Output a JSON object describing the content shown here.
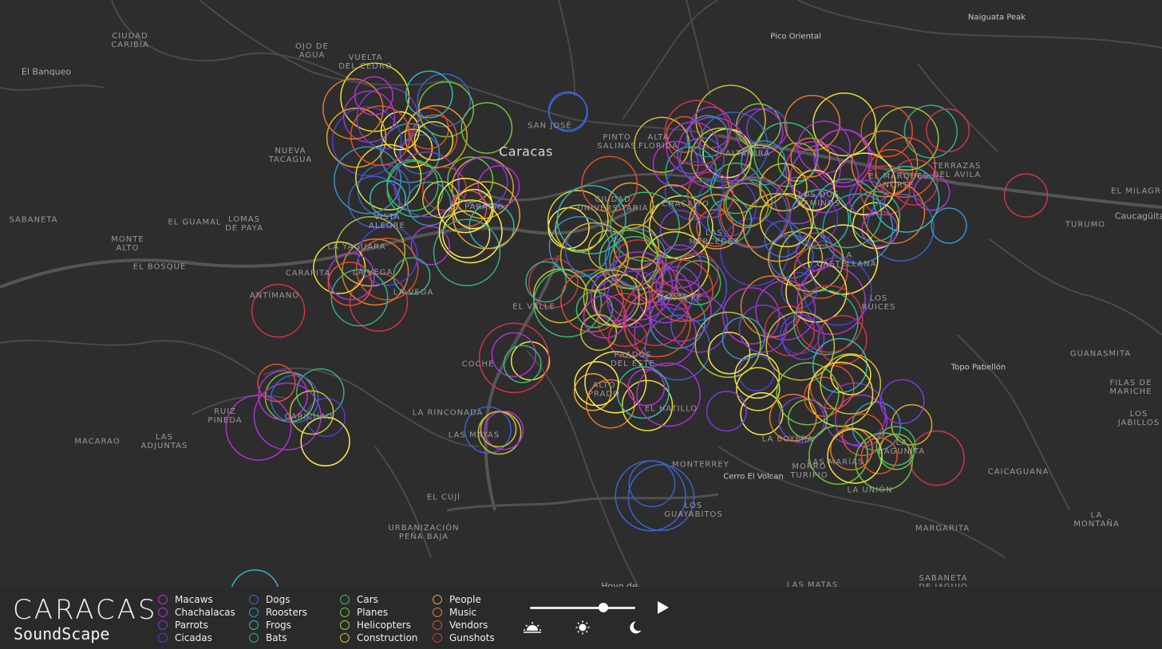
{
  "map": {
    "city_label": "Caracas",
    "place_labels": [
      "CIUDAD\nCARIBIA",
      "El Banqueo",
      "OJO DE\nAGUA",
      "VUELTA\nDEL CEDRO",
      "NUEVA\nTACAGUA",
      "SABANETA",
      "EL GUAMAL",
      "LOMAS\nDE PAYA",
      "MONTE\nALTO",
      "EL BOSQUE",
      "CARAPITA",
      "LA YAGUARA",
      "LA VEGA",
      "LA VEGA",
      "ANTÍMANO",
      "VISTA\nALEGRE",
      "EL PARAÍSO",
      "SAN JOSÉ",
      "PINTO\nSALINAS",
      "ALTA\nFLORIDA",
      "CIUDAD\nUNIVERSITARIA",
      "CHACAITO",
      "ALTAMIRA",
      "LAS\nMERCEDES",
      "EL VALLE",
      "SANTA FE",
      "COCHE",
      "PRADOS\nDEL ESTE",
      "ALTO\nPRADO",
      "EL HATILLO",
      "LA RINCONADA",
      "LAS MAYAS",
      "CARICUAO",
      "RUIZ\nPINEDA",
      "MACARAO",
      "LAS\nADJUNTAS",
      "EL CUJÍ",
      "URBANIZACIÓN\nPEÑA BAJA",
      "MONTERREY",
      "LOS\nGUAYABITOS",
      "LA BOYERA",
      "LAS MARÍAS",
      "LA UNIÓN",
      "MARGARITA",
      "SABANETA\nDE JAGUIO",
      "LAS MATAS",
      "LA\nLAGUNITA",
      "LA\nCASTELLANA",
      "LOS\nRUICES",
      "TERRAZAS\nDEL ÁVILA",
      "LOS DOS\nCAMINOS",
      "EL MILAGRO",
      "TURUMO",
      "GUANASMITA",
      "FILAS DE\nMARICHE",
      "LOS\nJABILLOS",
      "CAICAGUANA",
      "LA\nMONTAÑA",
      "EL MARQUÉS\nNORTE",
      "MORRO\nTURIPIO",
      "Hoyo de"
    ],
    "town_labels": [
      "Caucagüita"
    ],
    "peak_labels": [
      "Naiguata Peak",
      "Pico Oriental",
      "Topo Pabellón",
      "Cerro El Volcan"
    ]
  },
  "branding": {
    "title": "CARACAS",
    "subtitle": "SoundScape"
  },
  "legend": {
    "columns": [
      [
        {
          "label": "Macaws",
          "color": "#b52fd6"
        },
        {
          "label": "Chachalacas",
          "color": "#a634d0"
        },
        {
          "label": "Parrots",
          "color": "#7a3bd8"
        },
        {
          "label": "Cicadas",
          "color": "#4a3fd4"
        }
      ],
      [
        {
          "label": "Dogs",
          "color": "#3c62c9"
        },
        {
          "label": "Roosters",
          "color": "#3a8fc4"
        },
        {
          "label": "Frogs",
          "color": "#33b5b5"
        },
        {
          "label": "Bats",
          "color": "#35ad86"
        }
      ],
      [
        {
          "label": "Cars",
          "color": "#3cb96a"
        },
        {
          "label": "Planes",
          "color": "#6ec13c"
        },
        {
          "label": "Helicopters",
          "color": "#a9c23a"
        },
        {
          "label": "Construction",
          "color": "#cbbd33"
        }
      ],
      [
        {
          "label": "People",
          "color": "#e0a52e"
        },
        {
          "label": "Music",
          "color": "#e07b2c"
        },
        {
          "label": "Vendors",
          "color": "#de4f2f"
        },
        {
          "label": "Gunshots",
          "color": "#d23349"
        }
      ]
    ]
  },
  "controls": {
    "time_of_day_level": 0.7,
    "time_icons": [
      "sunrise-icon",
      "sun-icon",
      "moon-icon"
    ]
  }
}
